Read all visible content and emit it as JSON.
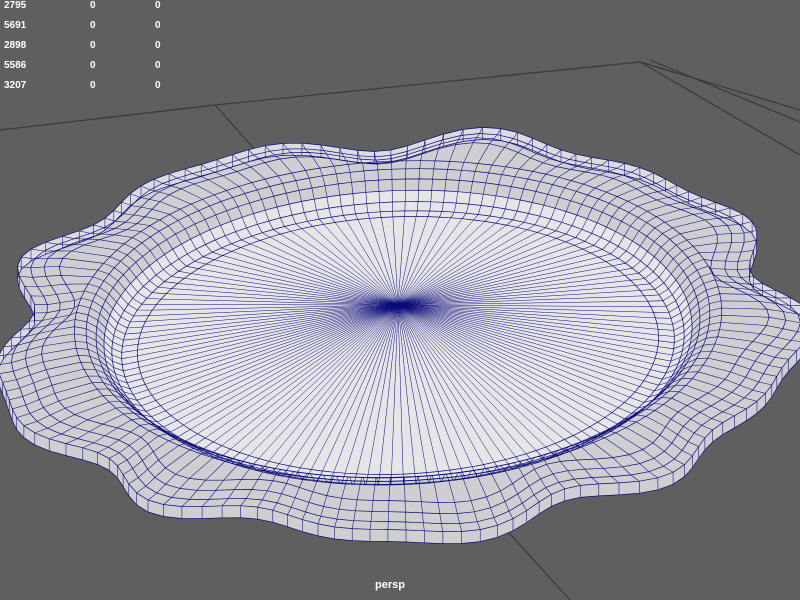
{
  "viewport": {
    "camera_name": "persp",
    "background_color": "#5f5f5f",
    "grid_color": "#3a3a3a",
    "wire_color": "#0b0b7a",
    "surface_color": "#dcdcde"
  },
  "hud": {
    "rows": [
      {
        "label": "2795",
        "v1": "0",
        "v2": "0"
      },
      {
        "label": "5691",
        "v1": "0",
        "v2": "0"
      },
      {
        "label": "2898",
        "v1": "0",
        "v2": "0"
      },
      {
        "label": "5586",
        "v1": "0",
        "v2": "0"
      },
      {
        "label": "3207",
        "v1": "0",
        "v2": "0"
      }
    ]
  },
  "model": {
    "name": "plate",
    "shape": "wavy-oval-plate-wireframe",
    "radial_segments": 140
  }
}
